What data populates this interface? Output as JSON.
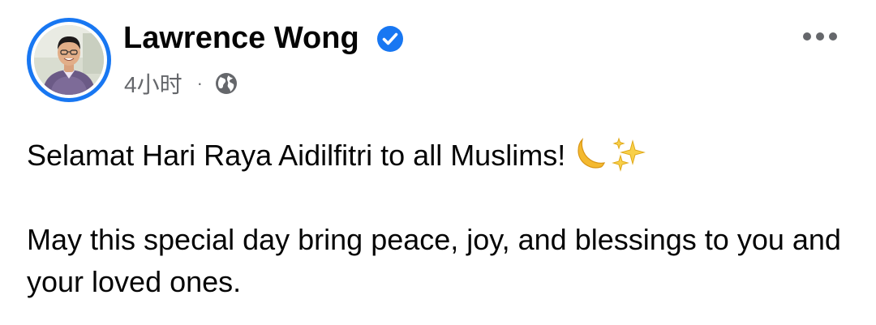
{
  "post": {
    "author": "Lawrence Wong",
    "verified": true,
    "timestamp": "4小时",
    "separator": "·",
    "audience_icon": "globe-icon",
    "menu_icon": "more-options-icon",
    "paragraphs": [
      "Selamat Hari Raya Aidilfitri to all Muslims!",
      "May this special day bring peace, joy, and blessings to you and your loved ones."
    ],
    "emojis": [
      "crescent-moon-icon",
      "sparkles-icon"
    ]
  },
  "colors": {
    "accent": "#1877f2",
    "text": "#050505",
    "secondary_text": "#65676b",
    "icon": "#65676b"
  }
}
